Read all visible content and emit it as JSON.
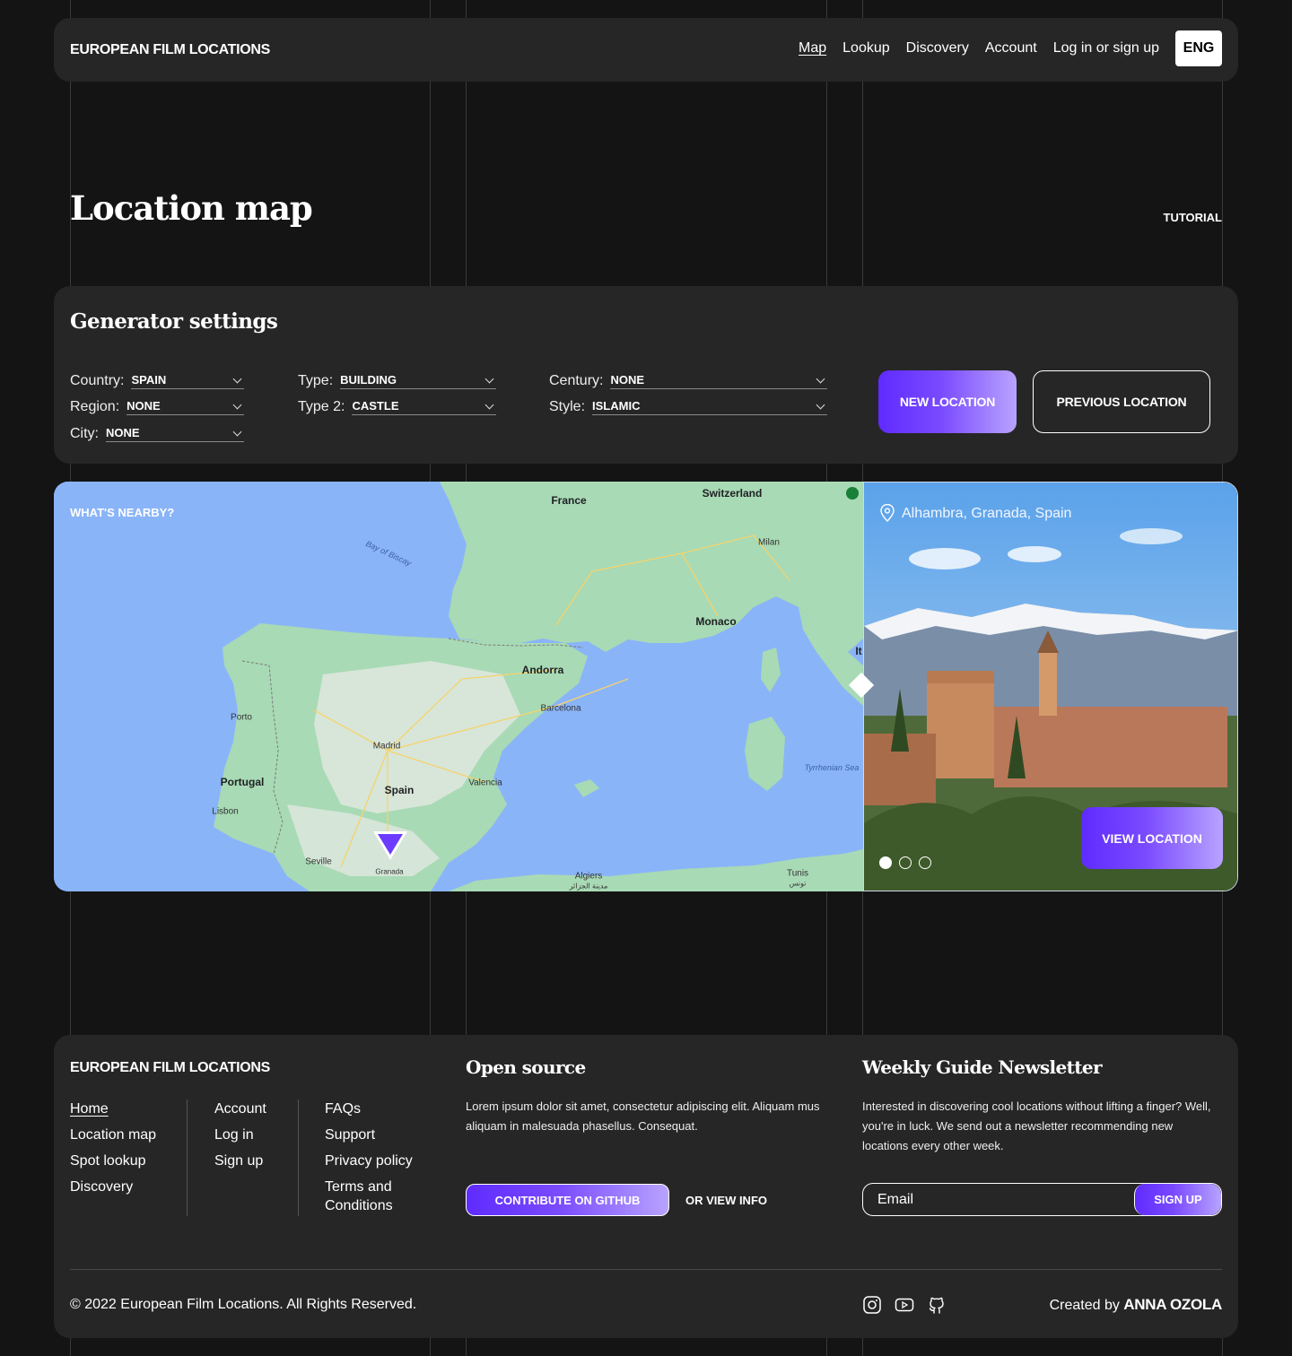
{
  "header": {
    "brand": "EUROPEAN FILM LOCATIONS",
    "nav": [
      "Map",
      "Lookup",
      "Discovery",
      "Account",
      "Log in or sign up"
    ],
    "lang": "ENG"
  },
  "page": {
    "title": "Location map",
    "tutorial": "TUTORIAL"
  },
  "generator": {
    "title": "Generator settings",
    "fields": {
      "country": {
        "label": "Country:",
        "value": "SPAIN"
      },
      "region": {
        "label": "Region:",
        "value": "NONE"
      },
      "city": {
        "label": "City:",
        "value": "NONE"
      },
      "type": {
        "label": "Type:",
        "value": "BUILDING"
      },
      "type2": {
        "label": "Type 2:",
        "value": "CASTLE"
      },
      "century": {
        "label": "Century:",
        "value": "NONE"
      },
      "style": {
        "label": "Style:",
        "value": "ISLAMIC"
      }
    },
    "new_location": "NEW LOCATION",
    "previous_location": "PREVIOUS LOCATION"
  },
  "map": {
    "nearby": "WHAT'S NEARBY?",
    "labels": {
      "france": "France",
      "switzerland": "Switzerland",
      "milan": "Milan",
      "monaco": "Monaco",
      "andorra": "Andorra",
      "barcelona": "Barcelona",
      "porto": "Porto",
      "portugal": "Portugal",
      "madrid": "Madrid",
      "spain": "Spain",
      "valencia": "Valencia",
      "lisbon": "Lisbon",
      "seville": "Seville",
      "granada": "Granada",
      "algiers": "Algiers",
      "algiers_ar": "مدينة الجزائر",
      "tunis": "Tunis",
      "tunis_ar": "تونس",
      "bay_of_biscay": "Bay of Biscay",
      "tyrrhenian": "Tyrrhenian Sea",
      "it": "It"
    },
    "colors": {
      "sea": "#8ab4f8",
      "land": "#a8dab5",
      "land_light": "#e8eae6",
      "marker": "#6b3cff"
    }
  },
  "photo": {
    "location": "Alhambra, Granada, Spain",
    "view": "VIEW LOCATION",
    "active_slide": 1,
    "slides": 3
  },
  "footer": {
    "brand": "EUROPEAN FILM LOCATIONS",
    "col1": [
      "Home",
      "Location map",
      "Spot lookup",
      "Discovery"
    ],
    "col2": [
      "Account",
      "Log in",
      "Sign up"
    ],
    "col3": [
      "FAQs",
      "Support",
      "Privacy policy",
      "Terms and Conditions"
    ],
    "open_source": {
      "title": "Open source",
      "text": "Lorem ipsum dolor sit amet, consectetur adipiscing elit. Aliquam mus aliquam in malesuada phasellus. Consequat.",
      "github": "CONTRIBUTE ON GITHUB",
      "view_info": "OR VIEW INFO"
    },
    "newsletter": {
      "title": "Weekly Guide Newsletter",
      "text": "Interested in discovering cool locations without lifting a finger? Well, you're in luck. We send out a newsletter recommending new locations every other week.",
      "placeholder": "Email",
      "signup": "SIGN UP"
    },
    "copyright": "© 2022 European Film Locations. All Rights Reserved.",
    "credit_prefix": "Created by",
    "credit_name": "ANNA OZOLA"
  }
}
